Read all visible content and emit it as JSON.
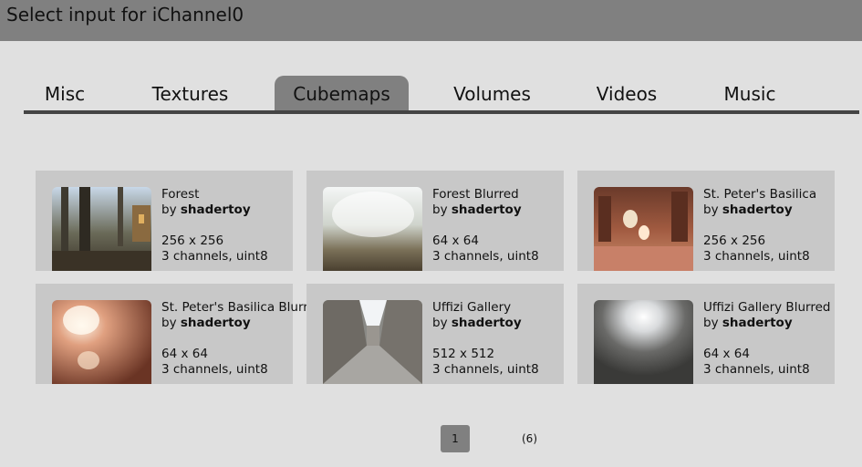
{
  "window": {
    "title": "Select input for iChannel0"
  },
  "tabs": [
    {
      "label": "Misc"
    },
    {
      "label": "Textures"
    },
    {
      "label": "Cubemaps",
      "active": true
    },
    {
      "label": "Volumes"
    },
    {
      "label": "Videos"
    },
    {
      "label": "Music"
    }
  ],
  "cards": [
    {
      "name": "Forest",
      "by": "by",
      "author": "shadertoy",
      "size": "256 x 256",
      "format": "3 channels, uint8"
    },
    {
      "name": "Forest Blurred",
      "by": "by",
      "author": "shadertoy",
      "size": "64 x 64",
      "format": "3 channels, uint8"
    },
    {
      "name": "St. Peter's Basilica",
      "by": "by",
      "author": "shadertoy",
      "size": "256 x 256",
      "format": "3 channels, uint8"
    },
    {
      "name": "St. Peter's Basilica Blurred",
      "by": "by",
      "author": "shadertoy",
      "size": "64 x 64",
      "format": "3 channels, uint8"
    },
    {
      "name": "Uffizi Gallery",
      "by": "by",
      "author": "shadertoy",
      "size": "512 x 512",
      "format": "3 channels, uint8"
    },
    {
      "name": "Uffizi Gallery Blurred",
      "by": "by",
      "author": "shadertoy",
      "size": "64 x 64",
      "format": "3 channels, uint8"
    }
  ],
  "pagination": {
    "current": "1",
    "total": "(6)"
  },
  "colors": {
    "titlebar": "#808080",
    "background": "#e0e0e0",
    "card": "#c8c8c8",
    "active_tab": "#808080"
  }
}
